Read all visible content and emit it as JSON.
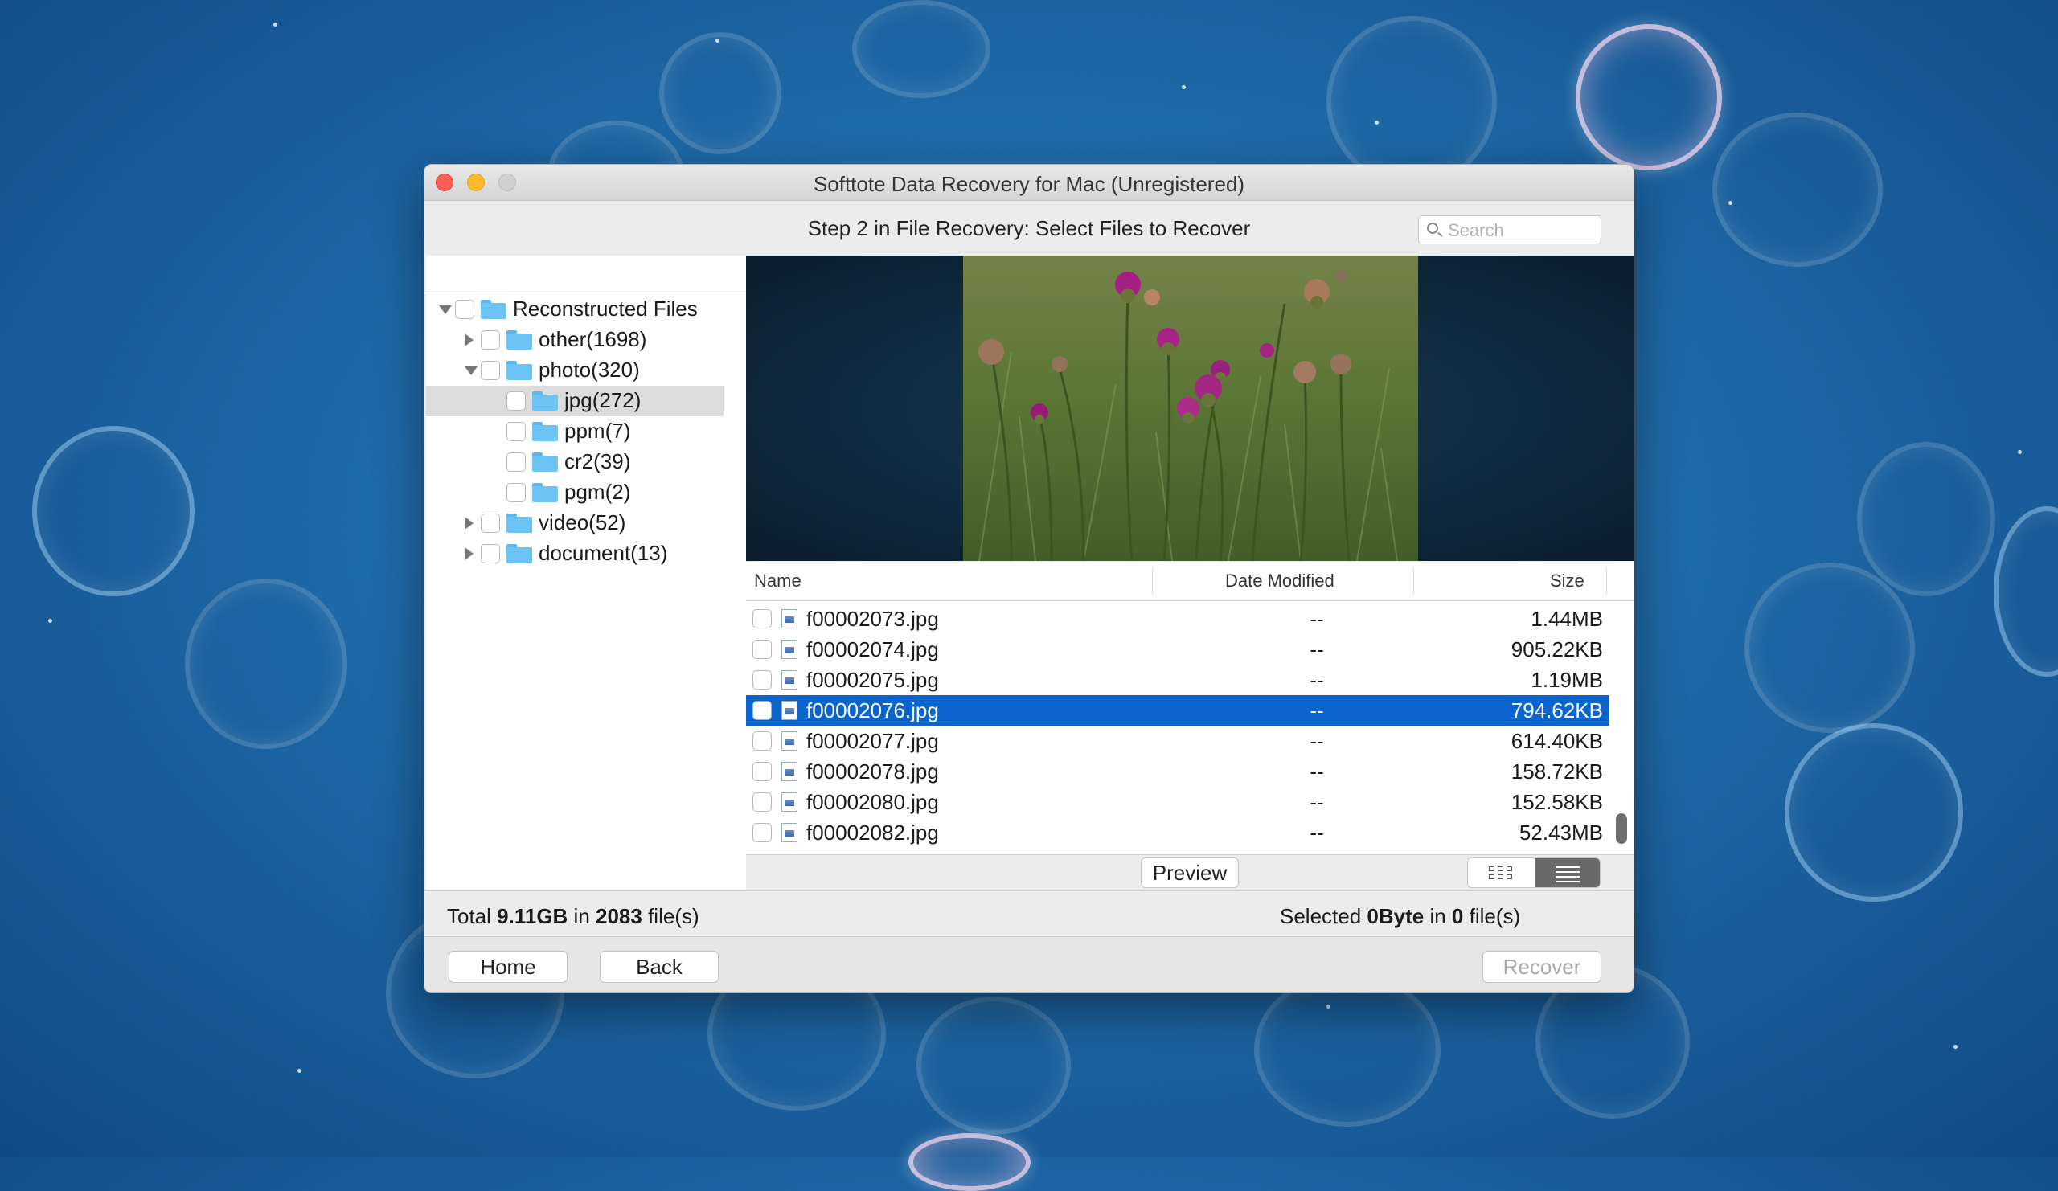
{
  "window": {
    "title": "Softtote Data Recovery for Mac (Unregistered)"
  },
  "step": {
    "title": "Step 2 in File Recovery: Select Files to Recover"
  },
  "search": {
    "placeholder": "Search"
  },
  "tree": {
    "items": [
      {
        "label": "Reconstructed Files",
        "level": 0,
        "arrow": "down"
      },
      {
        "label": "other(1698)",
        "level": 1,
        "arrow": "right"
      },
      {
        "label": "photo(320)",
        "level": 1,
        "arrow": "down"
      },
      {
        "label": "jpg(272)",
        "level": 2,
        "arrow": "",
        "selected": true
      },
      {
        "label": "ppm(7)",
        "level": 2,
        "arrow": ""
      },
      {
        "label": "cr2(39)",
        "level": 2,
        "arrow": ""
      },
      {
        "label": "pgm(2)",
        "level": 2,
        "arrow": ""
      },
      {
        "label": "video(52)",
        "level": 1,
        "arrow": "right"
      },
      {
        "label": "document(13)",
        "level": 1,
        "arrow": "right"
      }
    ]
  },
  "list": {
    "columns": {
      "name": "Name",
      "date": "Date Modified",
      "size": "Size"
    },
    "rows": [
      {
        "name": "f00002073.jpg",
        "date": "--",
        "size": "1.44MB"
      },
      {
        "name": "f00002074.jpg",
        "date": "--",
        "size": "905.22KB"
      },
      {
        "name": "f00002075.jpg",
        "date": "--",
        "size": "1.19MB"
      },
      {
        "name": "f00002076.jpg",
        "date": "--",
        "size": "794.62KB",
        "selected": true
      },
      {
        "name": "f00002077.jpg",
        "date": "--",
        "size": "614.40KB"
      },
      {
        "name": "f00002078.jpg",
        "date": "--",
        "size": "158.72KB"
      },
      {
        "name": "f00002080.jpg",
        "date": "--",
        "size": "152.58KB"
      },
      {
        "name": "f00002082.jpg",
        "date": "--",
        "size": "52.43MB"
      }
    ]
  },
  "toolbar": {
    "preview_label": "Preview"
  },
  "status": {
    "total_prefix": "Total ",
    "total_size": "9.11GB",
    "total_mid": " in ",
    "total_count": "2083",
    "total_suffix": " file(s)",
    "selected_prefix": "Selected ",
    "selected_size": "0Byte",
    "selected_mid": " in ",
    "selected_count": "0",
    "selected_suffix": " file(s)"
  },
  "buttons": {
    "home": "Home",
    "back": "Back",
    "recover": "Recover"
  },
  "icons": {
    "search": "search-icon",
    "folder": "folder-icon",
    "file": "jpg-file-icon",
    "grid_view": "grid-view-icon",
    "list_view": "list-view-icon"
  },
  "colors": {
    "selection": "#0b63ce",
    "close": "#fc5f57",
    "minimize": "#fdbc2e",
    "folder": "#6cc4f5"
  }
}
